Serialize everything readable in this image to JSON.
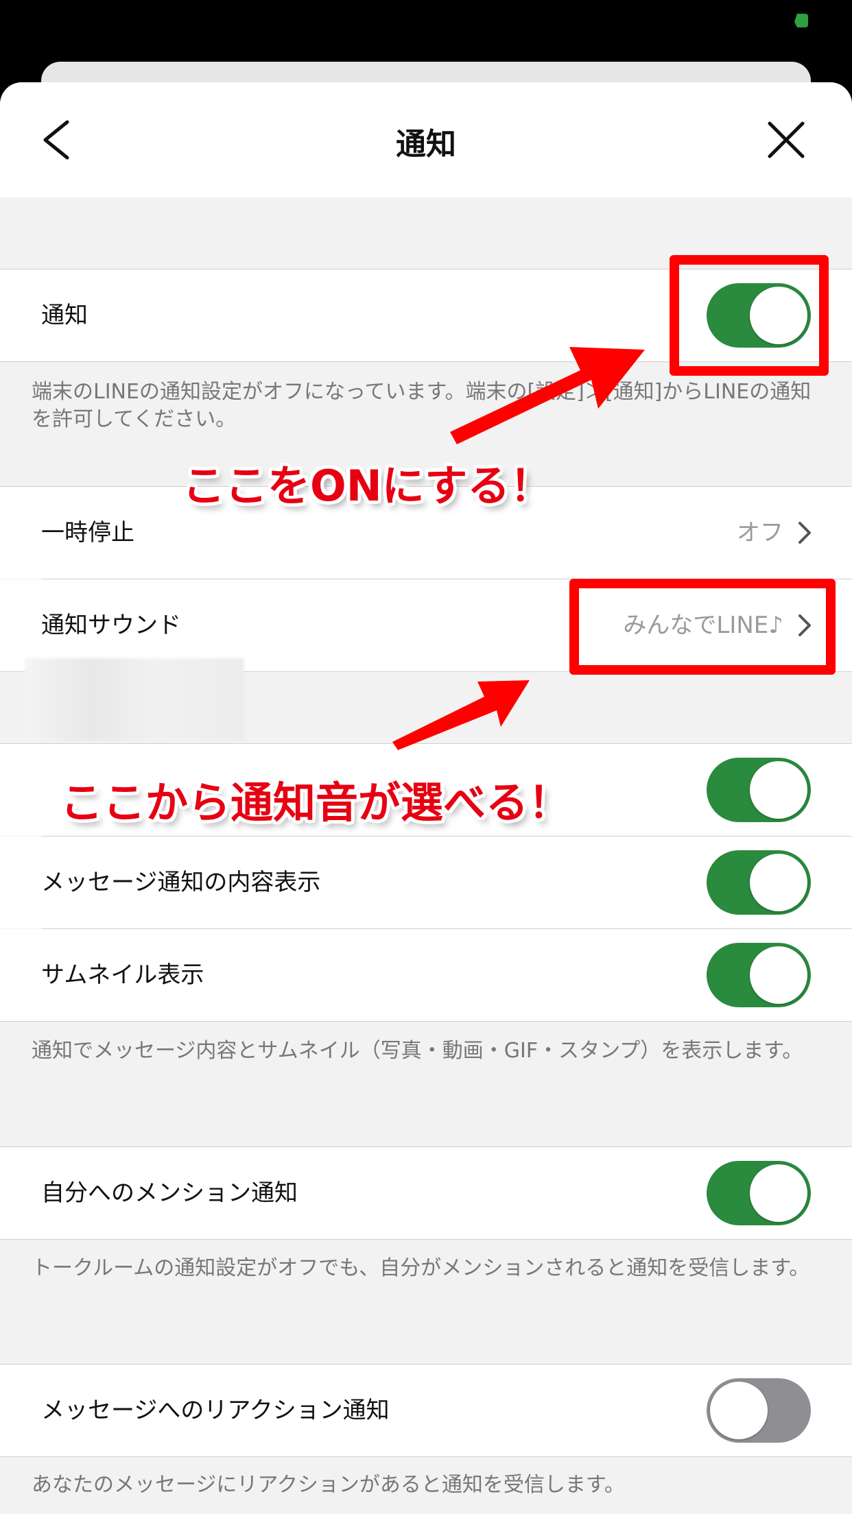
{
  "header": {
    "title": "通知"
  },
  "rows": {
    "notifications": {
      "label": "通知",
      "state": "on"
    },
    "pause": {
      "label": "一時停止",
      "value": "オフ"
    },
    "sound": {
      "label": "通知サウンド",
      "value": "みんなでLINE♪"
    },
    "new_message": {
      "label": "",
      "state": "on"
    },
    "message_preview": {
      "label": "メッセージ通知の内容表示",
      "state": "on"
    },
    "thumbnail": {
      "label": "サムネイル表示",
      "state": "on"
    },
    "mention": {
      "label": "自分へのメンション通知",
      "state": "on"
    },
    "reaction": {
      "label": "メッセージへのリアクション通知",
      "state": "off"
    }
  },
  "notes": {
    "device_off": "端末のLINEの通知設定がオフになっています。端末の[設定]＞[通知]からLINEの通知を許可してください。",
    "preview": "通知でメッセージ内容とサムネイル（写真・動画・GIF・スタンプ）を表示します。",
    "mention": "トークルームの通知設定がオフでも、自分がメンションされると通知を受信します。",
    "reaction": "あなたのメッセージにリアクションがあると通知を受信します。"
  },
  "annotations": {
    "turn_on": "ここをONにする！",
    "choose_sound": "ここから通知音が選べる！"
  },
  "colors": {
    "toggle_on": "#2a8a3e",
    "toggle_off": "#8e8e93",
    "annotation_red": "#e60012"
  },
  "icons": [
    "back-chevron-icon",
    "close-icon",
    "chevron-right-icon",
    "battery-icon"
  ]
}
